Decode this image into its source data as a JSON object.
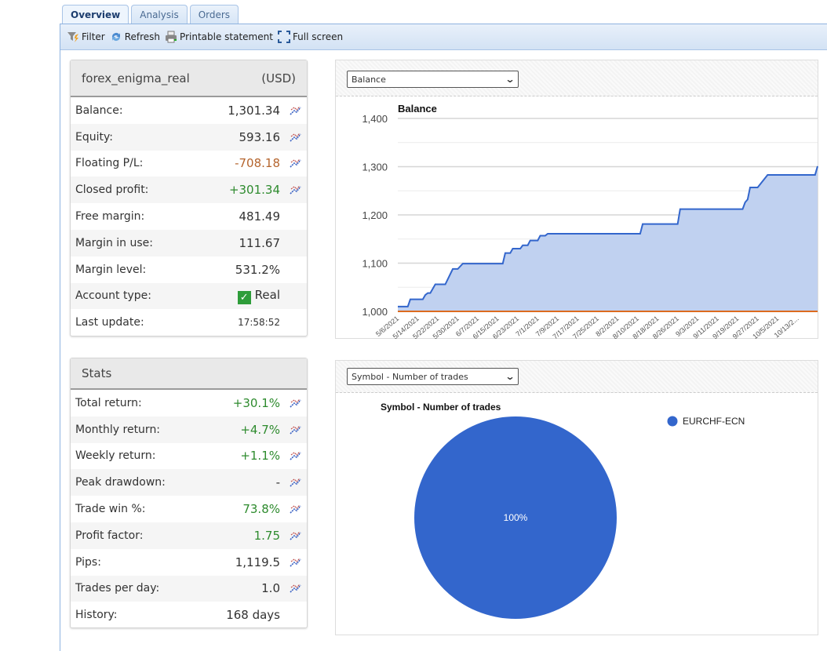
{
  "tabs": [
    "Overview",
    "Analysis",
    "Orders"
  ],
  "toolbar": {
    "filter": "Filter",
    "refresh": "Refresh",
    "print": "Printable statement",
    "fullscreen": "Full screen"
  },
  "account": {
    "name": "forex_enigma_real",
    "currency": "(USD)",
    "rows": [
      {
        "label": "Balance:",
        "value": "1,301.34",
        "tone": "",
        "chart": true
      },
      {
        "label": "Equity:",
        "value": "593.16",
        "tone": "",
        "chart": true
      },
      {
        "label": "Floating P/L:",
        "value": "-708.18",
        "tone": "neg",
        "chart": true
      },
      {
        "label": "Closed profit:",
        "value": "+301.34",
        "tone": "pos",
        "chart": true
      },
      {
        "label": "Free margin:",
        "value": "481.49",
        "tone": "",
        "chart": false
      },
      {
        "label": "Margin in use:",
        "value": "111.67",
        "tone": "",
        "chart": false
      },
      {
        "label": "Margin level:",
        "value": "531.2%",
        "tone": "",
        "chart": false
      },
      {
        "label": "Account type:",
        "value": "Real",
        "tone": "",
        "chart": false,
        "check": true
      },
      {
        "label": "Last update:",
        "value": "17:58:52",
        "tone": "",
        "chart": false,
        "small": true
      }
    ]
  },
  "stats": {
    "title": "Stats",
    "rows": [
      {
        "label": "Total return:",
        "value": "+30.1%",
        "tone": "pos",
        "chart": true
      },
      {
        "label": "Monthly return:",
        "value": "+4.7%",
        "tone": "pos",
        "chart": true
      },
      {
        "label": "Weekly return:",
        "value": "+1.1%",
        "tone": "pos",
        "chart": true
      },
      {
        "label": "Peak drawdown:",
        "value": "-",
        "tone": "",
        "chart": true
      },
      {
        "label": "Trade win %:",
        "value": "73.8%",
        "tone": "pos",
        "chart": true
      },
      {
        "label": "Profit factor:",
        "value": "1.75",
        "tone": "pos",
        "chart": true
      },
      {
        "label": "Pips:",
        "value": "1,119.5",
        "tone": "",
        "chart": true
      },
      {
        "label": "Trades per day:",
        "value": "1.0",
        "tone": "",
        "chart": true
      },
      {
        "label": "History:",
        "value": "168 days",
        "tone": "",
        "chart": false
      }
    ]
  },
  "balance_select": "Balance",
  "pie_select": "Symbol - Number of trades",
  "chart_data": [
    {
      "type": "area",
      "title": "Balance",
      "ylim": [
        1000,
        1400
      ],
      "yticks": [
        "1,000",
        "1,100",
        "1,200",
        "1,300",
        "1,400"
      ],
      "xticks": [
        "5/6/2021",
        "5/14/2021",
        "5/22/2021",
        "5/30/2021",
        "6/7/2021",
        "6/15/2021",
        "6/23/2021",
        "7/1/2021",
        "7/9/2021",
        "7/17/2021",
        "7/25/2021",
        "8/2/2021",
        "8/10/2021",
        "8/18/2021",
        "8/26/2021",
        "9/3/2021",
        "9/11/2021",
        "9/19/2021",
        "9/27/2021",
        "10/5/2021",
        "10/13/2..."
      ],
      "xlim": [
        "2021-05-06",
        "2021-10-21"
      ],
      "grid": true,
      "colors": {
        "balance": "#3366cc",
        "fill": "#c0d1f0",
        "base": "#dc6b1f"
      },
      "series": [
        {
          "points": [
            [
              "2021-05-06",
              1010
            ],
            [
              "2021-05-10",
              1010
            ],
            [
              "2021-05-11",
              1025
            ],
            [
              "2021-05-16",
              1025
            ],
            [
              "2021-05-17",
              1034
            ],
            [
              "2021-05-18",
              1038
            ],
            [
              "2021-05-19",
              1038
            ],
            [
              "2021-05-21",
              1056
            ],
            [
              "2021-05-25",
              1056
            ],
            [
              "2021-05-28",
              1088
            ],
            [
              "2021-05-30",
              1088
            ],
            [
              "2021-06-01",
              1099
            ],
            [
              "2021-06-17",
              1099
            ],
            [
              "2021-06-18",
              1121
            ],
            [
              "2021-06-20",
              1121
            ],
            [
              "2021-06-21",
              1130
            ],
            [
              "2021-06-24",
              1130
            ],
            [
              "2021-06-25",
              1137
            ],
            [
              "2021-06-27",
              1137
            ],
            [
              "2021-06-28",
              1147
            ],
            [
              "2021-07-01",
              1147
            ],
            [
              "2021-07-02",
              1157
            ],
            [
              "2021-07-04",
              1157
            ],
            [
              "2021-07-05",
              1161
            ],
            [
              "2021-08-11",
              1161
            ],
            [
              "2021-08-12",
              1181
            ],
            [
              "2021-08-26",
              1181
            ],
            [
              "2021-08-27",
              1212
            ],
            [
              "2021-09-21",
              1212
            ],
            [
              "2021-09-22",
              1226
            ],
            [
              "2021-09-23",
              1232
            ],
            [
              "2021-09-24",
              1257
            ],
            [
              "2021-09-27",
              1257
            ],
            [
              "2021-10-01",
              1283
            ],
            [
              "2021-10-20",
              1283
            ],
            [
              "2021-10-21",
              1301
            ]
          ]
        },
        {
          "points": [
            [
              "2021-05-06",
              1000
            ],
            [
              "2021-10-21",
              1000
            ]
          ]
        }
      ]
    },
    {
      "type": "pie",
      "title": "Symbol - Number of trades",
      "slices": [
        {
          "name": "EURCHF-ECN",
          "value": 100,
          "label": "100%",
          "color": "#3366cc"
        }
      ],
      "legend": "right"
    }
  ]
}
